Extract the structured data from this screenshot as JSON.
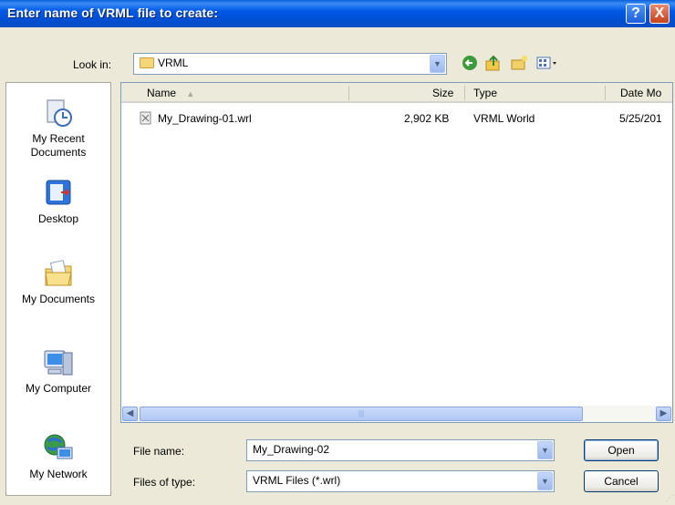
{
  "window": {
    "title": "Enter name of VRML file to create:",
    "help_glyph": "?",
    "close_glyph": "X"
  },
  "lookin": {
    "label": "Look in:",
    "value": "VRML"
  },
  "toolbar": {
    "icons": [
      "back-icon",
      "up-folder-icon",
      "new-folder-icon",
      "view-menu-icon"
    ]
  },
  "places": [
    {
      "label": "My Recent Documents",
      "icon": "recent-documents-icon"
    },
    {
      "label": "Desktop",
      "icon": "desktop-icon"
    },
    {
      "label": "My Documents",
      "icon": "my-documents-icon"
    },
    {
      "label": "My Computer",
      "icon": "my-computer-icon"
    },
    {
      "label": "My Network",
      "icon": "my-network-icon"
    }
  ],
  "filelist": {
    "columns": [
      "Name",
      "Size",
      "Type",
      "Date Mo"
    ],
    "rows": [
      {
        "name": "My_Drawing-01.wrl",
        "size": "2,902 KB",
        "type": "VRML World",
        "date": "5/25/201"
      }
    ]
  },
  "filename": {
    "label": "File name:",
    "value": "My_Drawing-02"
  },
  "filetype": {
    "label": "Files of type:",
    "value": "VRML Files (*.wrl)"
  },
  "buttons": {
    "open": "Open",
    "cancel": "Cancel"
  },
  "colors": {
    "titlebar": "#0058e6",
    "dialog_bg": "#ece9d8",
    "border": "#7f9db9"
  }
}
